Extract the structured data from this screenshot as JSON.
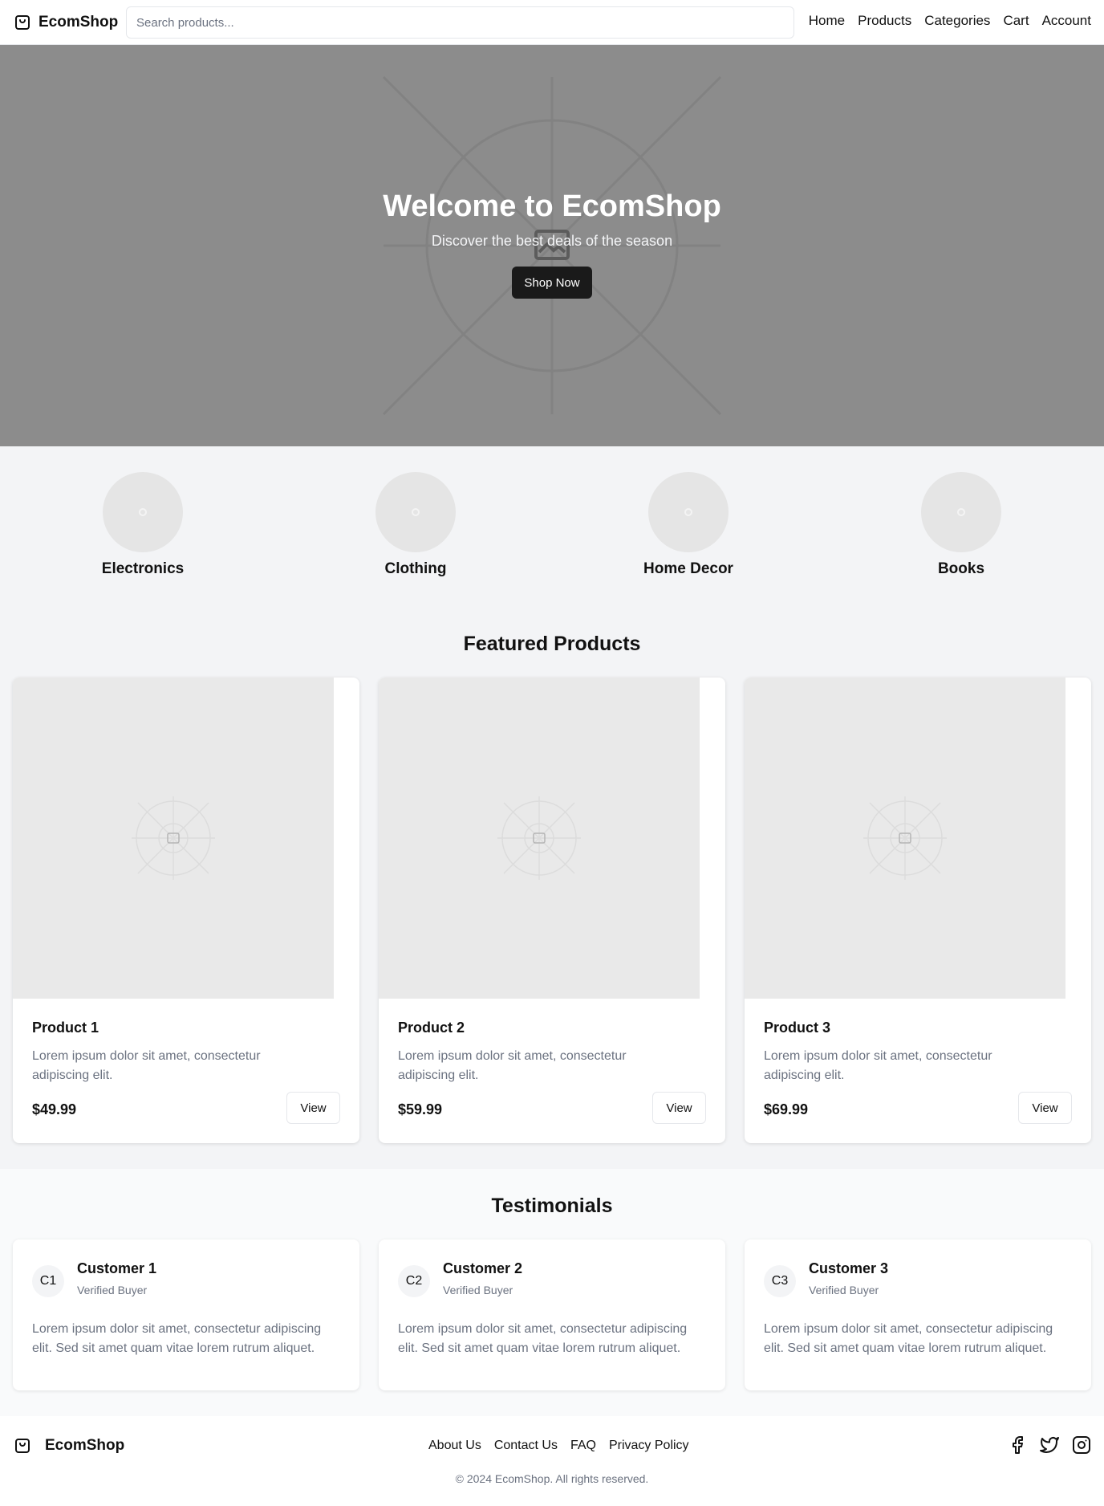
{
  "header": {
    "brand": "EcomShop",
    "search_placeholder": "Search products...",
    "nav": [
      "Home",
      "Products",
      "Categories",
      "Cart",
      "Account"
    ]
  },
  "hero": {
    "title": "Welcome to EcomShop",
    "subtitle": "Discover the best deals of the season",
    "cta": "Shop Now"
  },
  "categories": [
    "Electronics",
    "Clothing",
    "Home Decor",
    "Books"
  ],
  "featured": {
    "title": "Featured Products",
    "products": [
      {
        "name": "Product 1",
        "description": "Lorem ipsum dolor sit amet, consectetur adipiscing elit.",
        "price": "$49.99",
        "action": "View"
      },
      {
        "name": "Product 2",
        "description": "Lorem ipsum dolor sit amet, consectetur adipiscing elit.",
        "price": "$59.99",
        "action": "View"
      },
      {
        "name": "Product 3",
        "description": "Lorem ipsum dolor sit amet, consectetur adipiscing elit.",
        "price": "$69.99",
        "action": "View"
      }
    ]
  },
  "testimonials": {
    "title": "Testimonials",
    "items": [
      {
        "initials": "C1",
        "name": "Customer 1",
        "role": "Verified Buyer",
        "text": "Lorem ipsum dolor sit amet, consectetur adipiscing elit. Sed sit amet quam vitae lorem rutrum aliquet."
      },
      {
        "initials": "C2",
        "name": "Customer 2",
        "role": "Verified Buyer",
        "text": "Lorem ipsum dolor sit amet, consectetur adipiscing elit. Sed sit amet quam vitae lorem rutrum aliquet."
      },
      {
        "initials": "C3",
        "name": "Customer 3",
        "role": "Verified Buyer",
        "text": "Lorem ipsum dolor sit amet, consectetur adipiscing elit. Sed sit amet quam vitae lorem rutrum aliquet."
      }
    ]
  },
  "footer": {
    "brand": "EcomShop",
    "links": [
      "About Us",
      "Contact Us",
      "FAQ",
      "Privacy Policy"
    ],
    "social_icons": [
      "facebook-icon",
      "twitter-icon",
      "instagram-icon"
    ],
    "copyright": "© 2024 EcomShop. All rights reserved."
  }
}
